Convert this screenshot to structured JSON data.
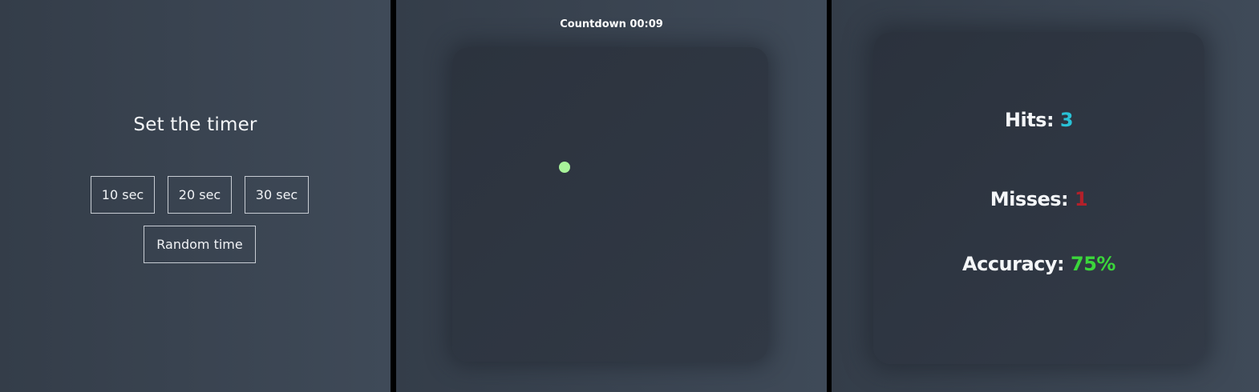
{
  "start": {
    "title": "Set the timer",
    "buttons": [
      "10 sec",
      "20 sec",
      "30 sec"
    ],
    "random_label": "Random time"
  },
  "game": {
    "countdown_label": "Countdown",
    "countdown_value": "00:09",
    "target_color": "#a8f39a"
  },
  "result": {
    "hits_label": "Hits:",
    "hits_value": "3",
    "hits_color": "#29c2d6",
    "misses_label": "Misses:",
    "misses_value": "1",
    "misses_color": "#b3202a",
    "accuracy_label": "Accuracy:",
    "accuracy_value": "75%",
    "accuracy_color": "#3bd63b"
  }
}
